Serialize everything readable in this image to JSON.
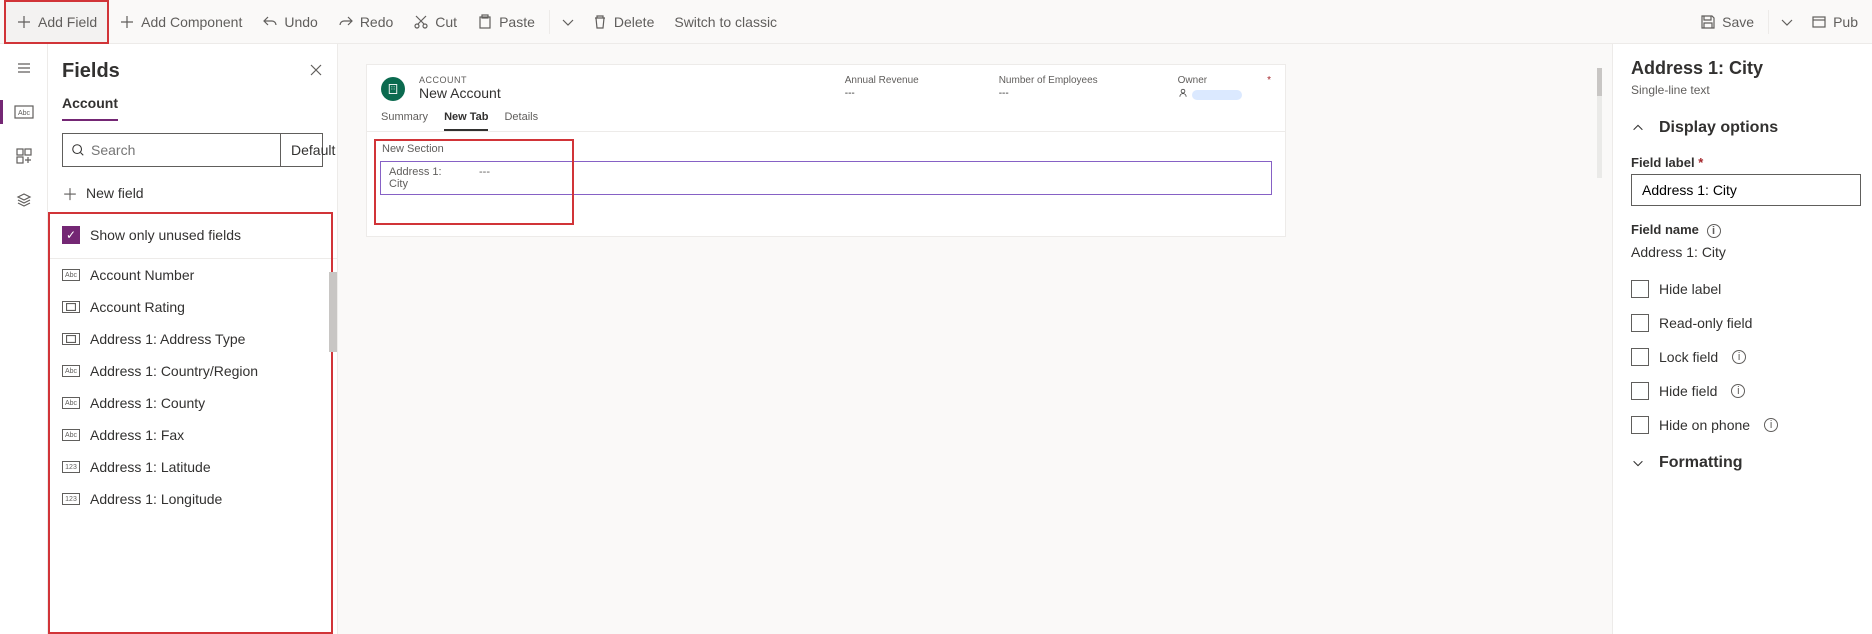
{
  "toolbar": {
    "add_field": "Add Field",
    "add_component": "Add Component",
    "undo": "Undo",
    "redo": "Redo",
    "cut": "Cut",
    "paste": "Paste",
    "delete": "Delete",
    "switch": "Switch to classic",
    "save": "Save",
    "publish": "Pub"
  },
  "fields_panel": {
    "title": "Fields",
    "tab": "Account",
    "search_placeholder": "Search",
    "sort_label": "Default",
    "new_field": "New field",
    "unused_label": "Show only unused fields",
    "items": [
      {
        "icon": "Abc",
        "label": "Account Number"
      },
      {
        "icon": "drop",
        "label": "Account Rating"
      },
      {
        "icon": "drop",
        "label": "Address 1: Address Type"
      },
      {
        "icon": "Abc",
        "label": "Address 1: Country/Region"
      },
      {
        "icon": "Abc",
        "label": "Address 1: County"
      },
      {
        "icon": "Abc",
        "label": "Address 1: Fax"
      },
      {
        "icon": "123",
        "label": "Address 1: Latitude"
      },
      {
        "icon": "123",
        "label": "Address 1: Longitude"
      }
    ]
  },
  "canvas": {
    "entity": "ACCOUNT",
    "record": "New Account",
    "header_cols": [
      {
        "label": "Annual Revenue",
        "value": "---"
      },
      {
        "label": "Number of Employees",
        "value": "---"
      },
      {
        "label": "Owner",
        "value": ""
      }
    ],
    "tabs": [
      "Summary",
      "New Tab",
      "Details"
    ],
    "active_tab": 1,
    "section_title": "New Section",
    "field_label": "Address 1: City",
    "field_value": "---"
  },
  "props": {
    "title": "Address 1: City",
    "subtype": "Single-line text",
    "group1": "Display options",
    "field_label_lbl": "Field label",
    "field_label_val": "Address 1: City",
    "field_name_lbl": "Field name",
    "field_name_val": "Address 1: City",
    "checks": [
      "Hide label",
      "Read-only field",
      "Lock field",
      "Hide field",
      "Hide on phone"
    ],
    "group2": "Formatting"
  }
}
